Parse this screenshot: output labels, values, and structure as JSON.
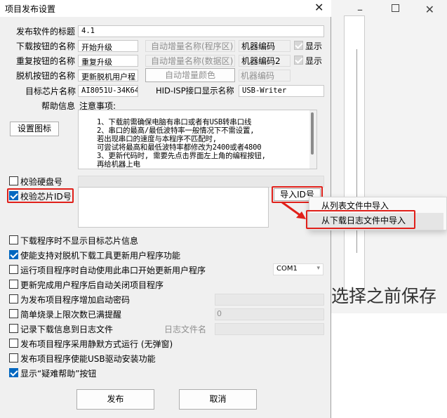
{
  "dialog": {
    "title": "项目发布设置",
    "close": "✕"
  },
  "form": {
    "software_title_label": "发布软件的标题",
    "software_title_value": "4.1",
    "download_btn_label": "下载按钮的名称",
    "download_btn_value": "开始升级",
    "retry_btn_label": "重复按钮的名称",
    "retry_btn_value": "重复升级",
    "offline_btn_label": "脱机按钮的名称",
    "offline_btn_value": "更新脱机用户程",
    "auto_inc_program": "自动增量名称(程序区)",
    "auto_inc_data": "自动增量名称(数据区)",
    "auto_inc_color": "自动增量颜色",
    "machine_code": "机器编码",
    "machine_code2": "机器编码2",
    "machine_code3": "机器编码",
    "show1": "显示",
    "show2": "显示",
    "target_chip_label": "目标芯片名称",
    "target_chip_value": "AI8051U-34K64",
    "hid_label": "HID-ISP接口显示名称",
    "hid_value": "USB-Writer",
    "help_label": "帮助信息",
    "set_icon_btn": "设置图标"
  },
  "help_text": {
    "heading": "注意事项:",
    "lines": [
      "1、下载前需确保电脑有串口或者有USB转串口线",
      "2、串口的最高/最低波特率一般情况下不需设置,",
      "   若出现串口的速度与本程序不匹配时,",
      "   可尝试将最高和最低波特率都修改为2400或者4800",
      "3、更新代码时, 需要先点击界面左上角的编程按钮,",
      "   再给机器上电"
    ]
  },
  "checks": {
    "verify_disk": "校验硬盘号",
    "verify_chip_id": "校验芯片ID号",
    "import_id_btn": "导入ID号",
    "options": [
      {
        "label": "下载程序时不显示目标芯片信息",
        "checked": false
      },
      {
        "label": "使能支持对脱机下载工具更新用户程序功能",
        "checked": true
      },
      {
        "label": "运行项目程序时自动使用此串口开始更新用户程序",
        "checked": false
      },
      {
        "label": "更新完成用户程序后自动关闭项目程序",
        "checked": false
      },
      {
        "label": "为发布项目程序增加启动密码",
        "checked": false
      },
      {
        "label": "简单烧录上限次数已满提醒",
        "checked": false
      },
      {
        "label": "记录下载信息到日志文件",
        "checked": false
      },
      {
        "label": "发布项目程序采用静默方式运行 (无弹窗)",
        "checked": false
      },
      {
        "label": "发布项目程序使能USB驱动安装功能",
        "checked": false
      },
      {
        "label": "显示“疑难帮助”按钮",
        "checked": true
      }
    ],
    "com_port": "COM1",
    "count_value": "0",
    "log_file_label": "日志文件名"
  },
  "buttons": {
    "publish": "发布",
    "cancel": "取消"
  },
  "context_menu": {
    "item1": "从列表文件中导入",
    "item2": "从下载日志文件中导入"
  },
  "background": {
    "partial_text": "选择之前保存"
  },
  "colors": {
    "accent": "#0067c0",
    "highlight": "#e0201a"
  }
}
